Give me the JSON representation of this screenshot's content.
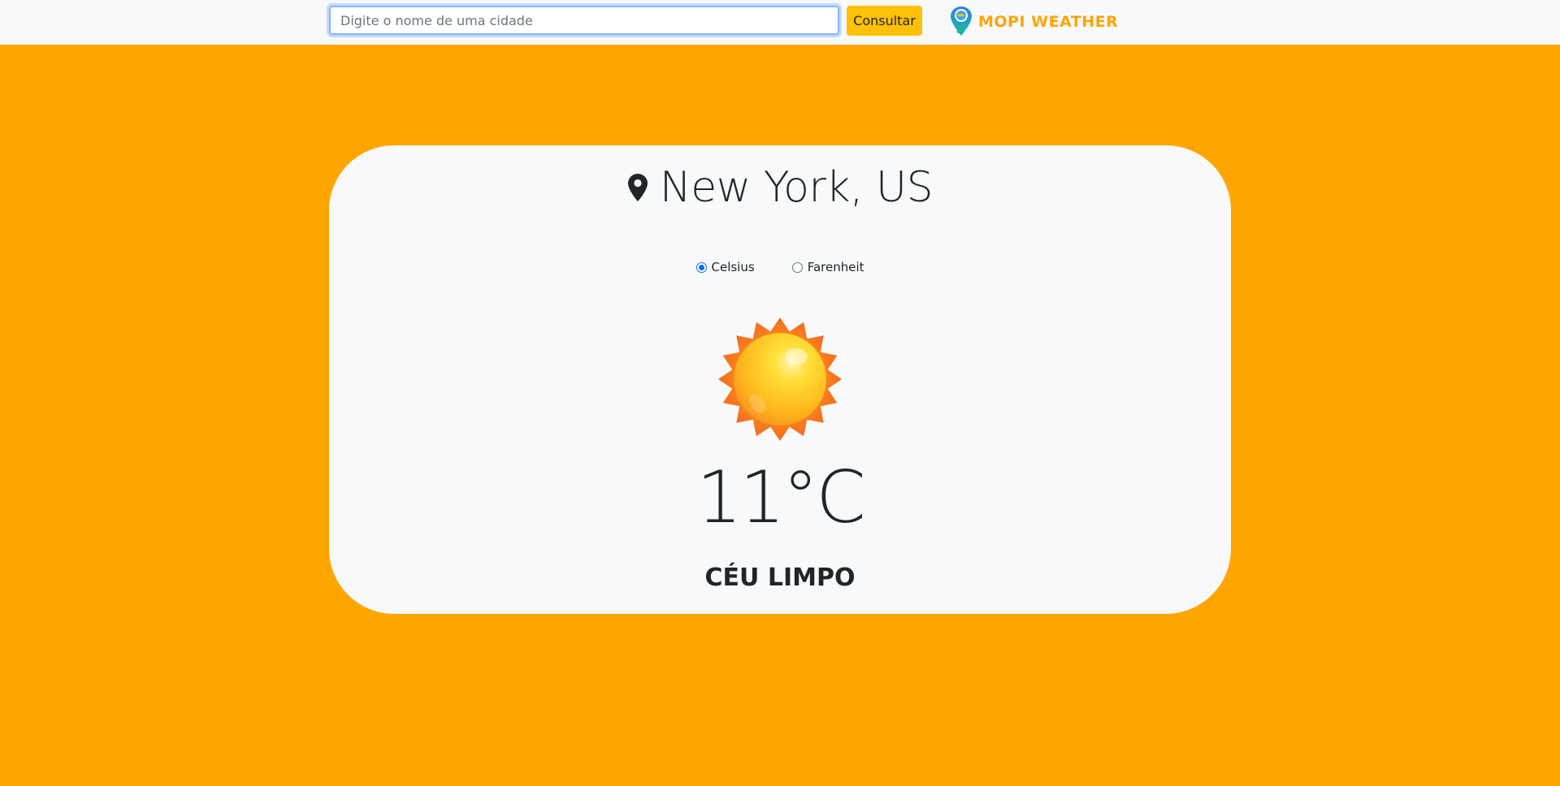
{
  "search": {
    "placeholder": "Digite o nome de uma cidade",
    "value": "",
    "button_label": "Consultar"
  },
  "brand": {
    "name": "MOPI WEATHER",
    "logo_icon": "map-pin-globe-icon"
  },
  "weather": {
    "location_icon": "map-pin-icon",
    "city": "New York, US",
    "units": [
      {
        "label": "Celsius",
        "checked": true
      },
      {
        "label": "Farenheit",
        "checked": false
      }
    ],
    "condition_icon": "sun-icon",
    "temperature": "11°C",
    "description": "CÉU LIMPO"
  },
  "colors": {
    "background": "#FFA500",
    "card": "#F8F9FA",
    "button": "#FFC107",
    "brand_text": "#FFA500",
    "radio_accent": "#0D6EFD"
  }
}
